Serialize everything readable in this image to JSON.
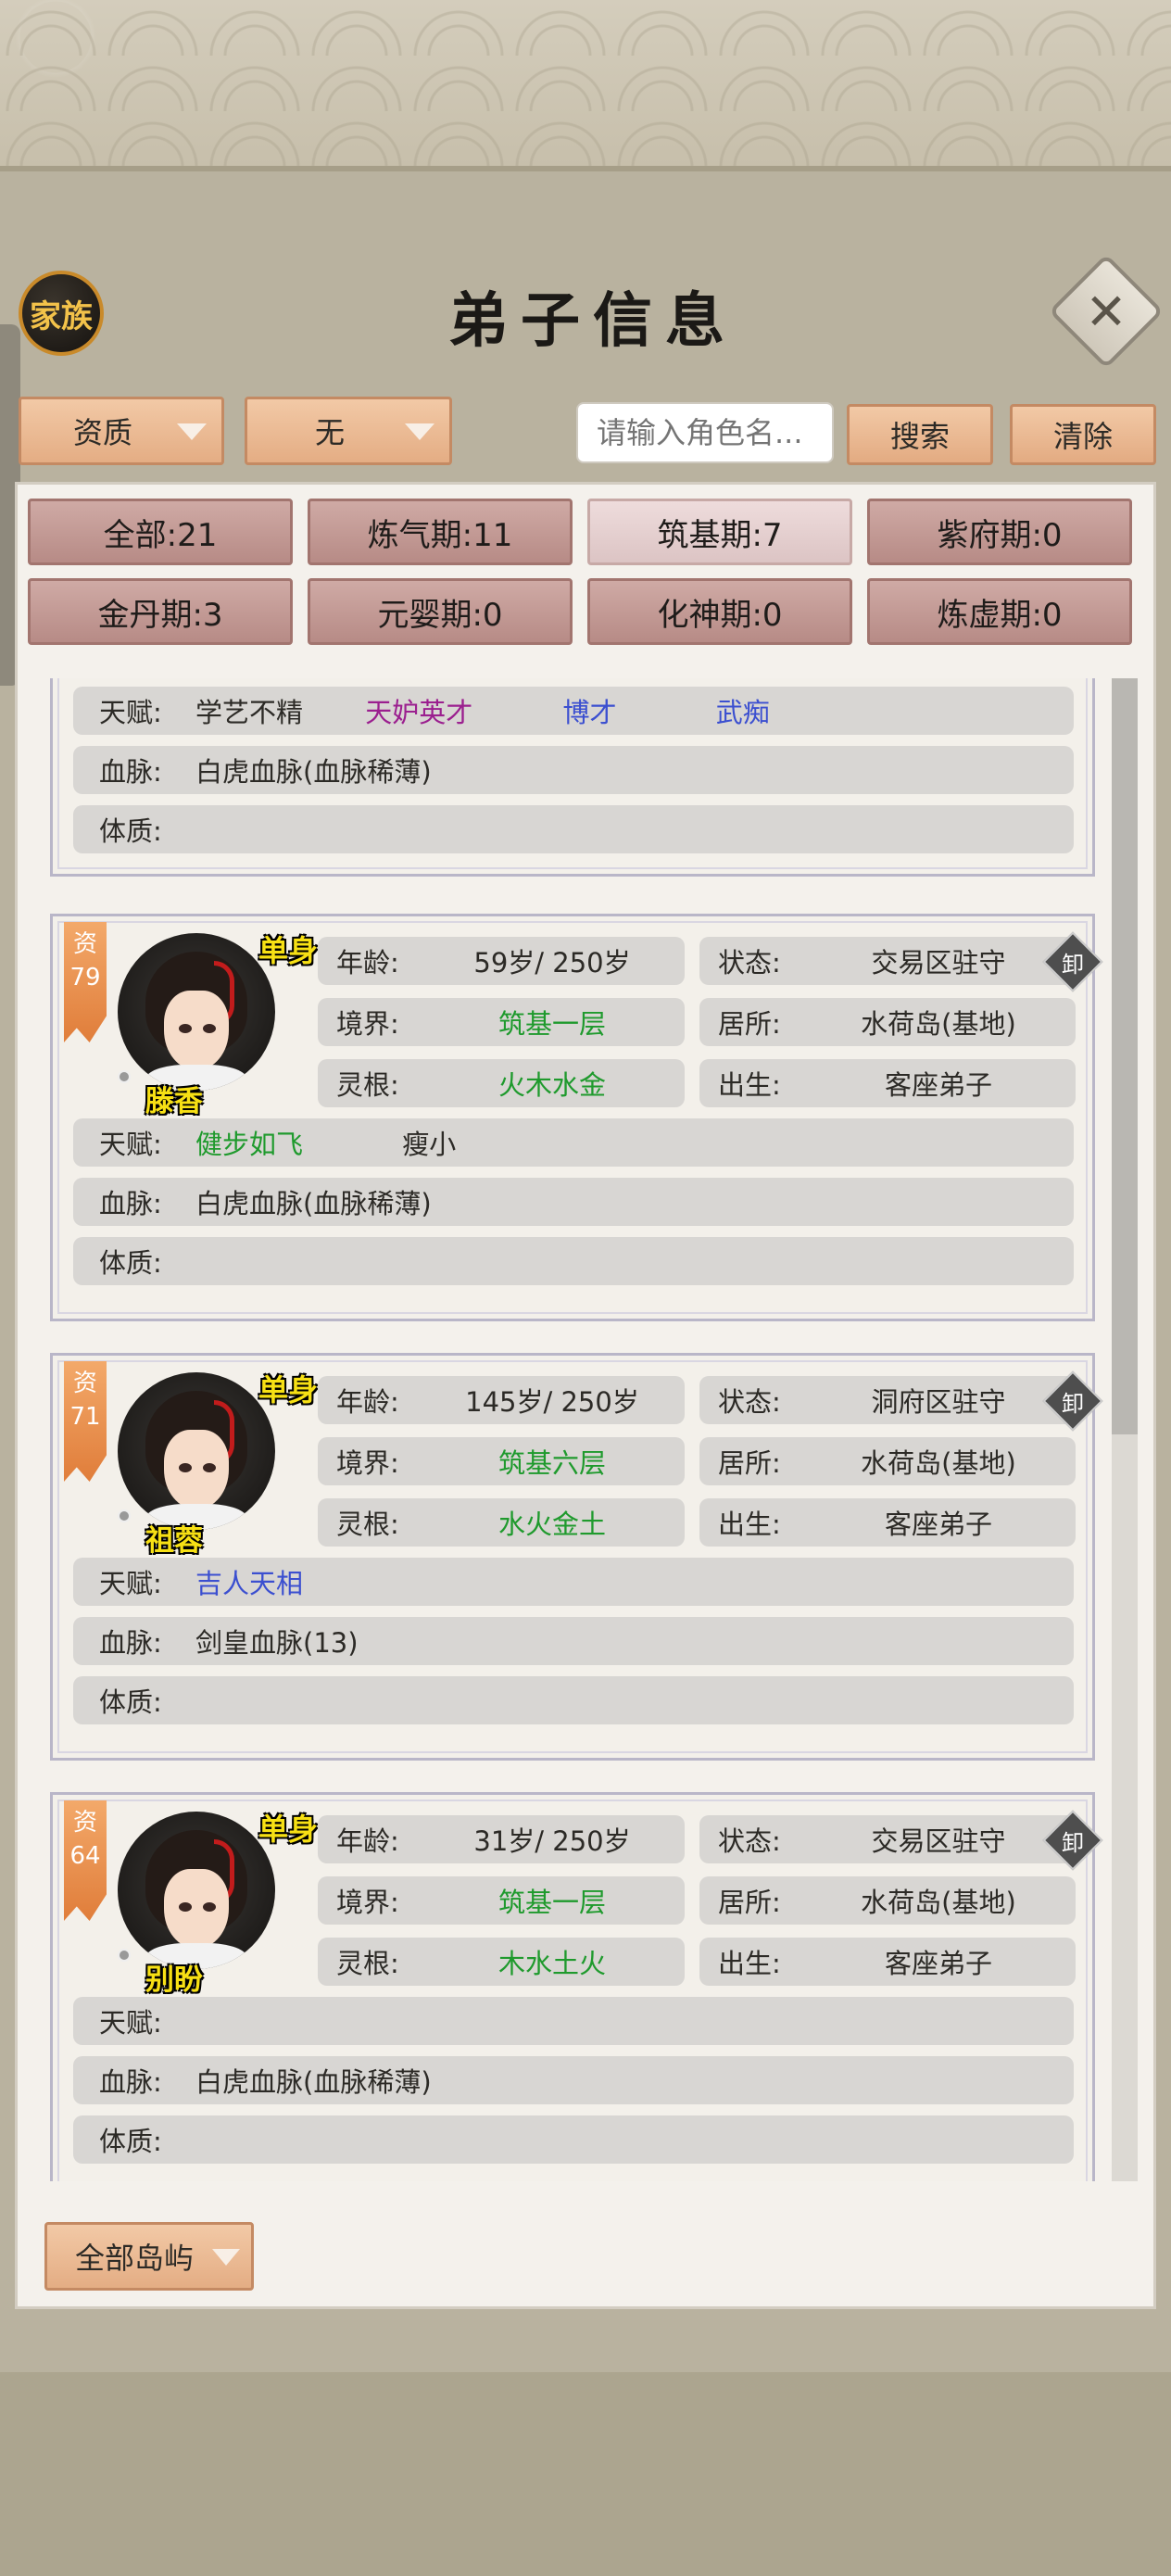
{
  "header": {
    "family_label": "家族",
    "title": "弟子信息"
  },
  "filters": {
    "aptitude": "资质",
    "secondary": "无",
    "search_placeholder": "请输入角色名...",
    "search_label": "搜索",
    "clear_label": "清除"
  },
  "stages": [
    {
      "label": "全部:21"
    },
    {
      "label": "炼气期:11"
    },
    {
      "label": "筑基期:7"
    },
    {
      "label": "紫府期:0"
    },
    {
      "label": "金丹期:3"
    },
    {
      "label": "元婴期:0"
    },
    {
      "label": "化神期:0"
    },
    {
      "label": "炼虚期:0"
    }
  ],
  "labels": {
    "age": "年龄:",
    "status": "状态:",
    "realm": "境界:",
    "residence": "居所:",
    "root": "灵根:",
    "origin": "出生:",
    "talent": "天赋:",
    "bloodline": "血脉:",
    "physique": "体质:",
    "aptitude_prefix": "资",
    "single": "单身",
    "unload": "卸"
  },
  "partial_card": {
    "talents": [
      "学艺不精",
      "天妒英才",
      "博才",
      "武痴"
    ],
    "bloodline": "白虎血脉(血脉稀薄)",
    "physique": ""
  },
  "disciples": [
    {
      "aptitude": "79",
      "name": "滕香",
      "age": "59岁/ 250岁",
      "status": "交易区驻守",
      "realm": "筑基一层",
      "residence": "水荷岛(基地)",
      "root": "火木水金",
      "origin": "客座弟子",
      "talents": [
        "健步如飞",
        "瘦小"
      ],
      "bloodline": "白虎血脉(血脉稀薄)",
      "physique": ""
    },
    {
      "aptitude": "71",
      "name": "祖蓉",
      "age": "145岁/ 250岁",
      "status": "洞府区驻守",
      "realm": "筑基六层",
      "residence": "水荷岛(基地)",
      "root": "水火金土",
      "origin": "客座弟子",
      "talents": [
        "吉人天相"
      ],
      "bloodline": "剑皇血脉(13)",
      "physique": ""
    },
    {
      "aptitude": "64",
      "name": "别盼",
      "age": "31岁/ 250岁",
      "status": "交易区驻守",
      "realm": "筑基一层",
      "residence": "水荷岛(基地)",
      "root": "木水土火",
      "origin": "客座弟子",
      "talents": [],
      "bloodline": "白虎血脉(血脉稀薄)",
      "physique": ""
    }
  ],
  "footer": {
    "island_filter": "全部岛屿"
  },
  "colors": {
    "button_orange": "#e4ad84",
    "stage_button": "#b78b86",
    "talent_green": "#1f9a2d",
    "talent_purple": "#9b1f8f",
    "talent_blue": "#3b4fd0",
    "name_yellow": "#f7e014"
  }
}
